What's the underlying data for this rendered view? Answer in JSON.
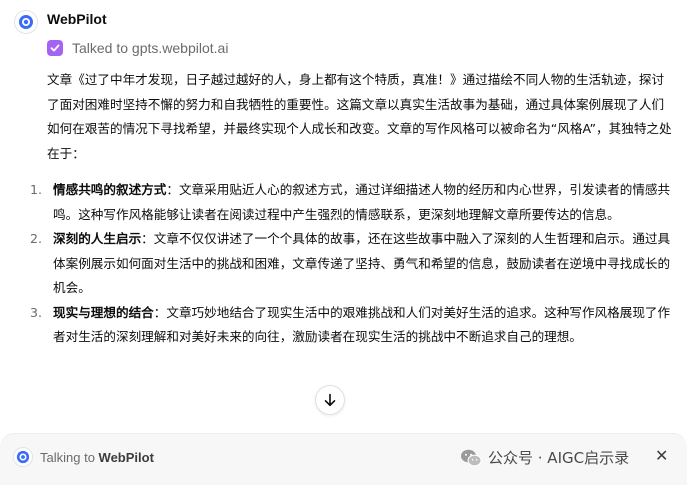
{
  "bot": {
    "name": "WebPilot",
    "tool_status": "Talked to gpts.webpilot.ai"
  },
  "message": {
    "intro": "文章《过了中年才发现，日子越过越好的人，身上都有这个特质，真准！》通过描绘不同人物的生活轨迹，探讨了面对困难时坚持不懈的努力和自我牺牲的重要性。这篇文章以真实生活故事为基础，通过具体案例展现了人们如何在艰苦的情况下寻找希望，并最终实现个人成长和改变。文章的写作风格可以被命名为“风格A”，其独特之处在于：",
    "items": [
      {
        "num": "1.",
        "title": "情感共鸣的叙述方式",
        "body": "：文章采用贴近人心的叙述方式，通过详细描述人物的经历和内心世界，引发读者的情感共鸣。这种写作风格能够让读者在阅读过程中产生强烈的情感联系，更深刻地理解文章所要传达的信息。"
      },
      {
        "num": "2.",
        "title": "深刻的人生启示",
        "body": "：文章不仅仅讲述了一个个具体的故事，还在这些故事中融入了深刻的人生哲理和启示。通过具体案例展示如何面对生活中的挑战和困难，文章传递了坚持、勇气和希望的信息，鼓励读者在逆境中寻找成长的机会。"
      },
      {
        "num": "3.",
        "title": "现实与理想的结合",
        "body": "：文章巧妙地结合了现实生活中的艰难挑战和人们对美好生活的追求。这种写作风格展现了作者对生活的深刻理解和对美好未来的向往，激励读者在现实生活的挑战中不断追求自己的理想。"
      }
    ]
  },
  "footer": {
    "talking_prefix": "Talking to",
    "talking_name": "WebPilot",
    "watermark": "公众号 · AIGC启示录",
    "close_symbol": "✕"
  },
  "colors": {
    "accent_purple": "#a463f2",
    "brand_blue": "#3b6cf5",
    "text": "#0d0d0d",
    "muted": "#6b6b6b"
  },
  "icons": [
    "webpilot-logo-icon",
    "check-icon",
    "arrow-down-icon",
    "wechat-icon",
    "close-icon"
  ]
}
